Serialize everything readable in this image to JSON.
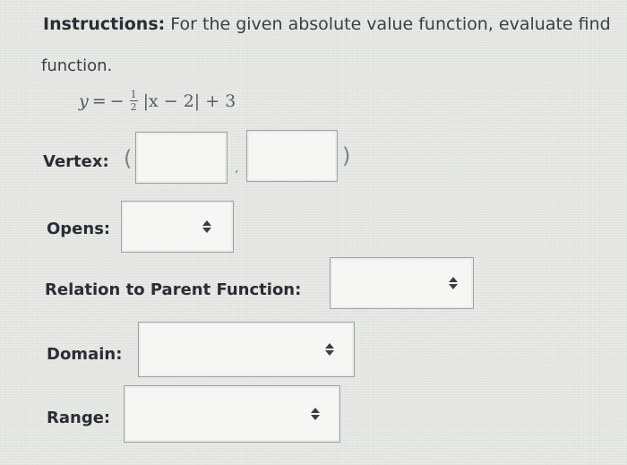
{
  "instructions": {
    "label": "Instructions:",
    "text": " For the given absolute value function, evaluate find",
    "line2": "function."
  },
  "equation": {
    "y": "y",
    "eq": "=",
    "minus": "−",
    "frac_num": "1",
    "frac_den": "2",
    "abs_expr": "|x − 2| + 3"
  },
  "vertex": {
    "label": "Vertex:",
    "open_paren": "(",
    "comma": ",",
    "close_paren": ")",
    "x_value": "",
    "y_value": ""
  },
  "opens": {
    "label": "Opens:",
    "selected": ""
  },
  "relation": {
    "label": "Relation to Parent Function:",
    "selected": ""
  },
  "domain": {
    "label": "Domain:",
    "selected": ""
  },
  "range": {
    "label": "Range:",
    "selected": ""
  },
  "icons": {
    "select_arrow": "up-down-arrow-icon"
  }
}
